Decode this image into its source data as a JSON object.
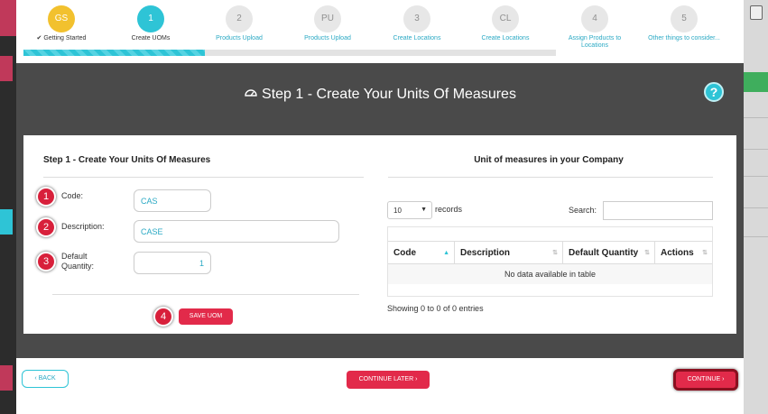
{
  "wizard": {
    "steps": [
      {
        "badge": "GS",
        "label": "Getting Started",
        "check": "✔",
        "state": "done"
      },
      {
        "badge": "1",
        "label": "Create UOMs",
        "state": "active"
      },
      {
        "badge": "2",
        "label": "Products Upload",
        "state": "todo"
      },
      {
        "badge": "PU",
        "label": "Products Upload",
        "state": "todo"
      },
      {
        "badge": "3",
        "label": "Create Locations",
        "state": "todo"
      },
      {
        "badge": "CL",
        "label": "Create Locations",
        "state": "todo"
      },
      {
        "badge": "4",
        "label": "Assign Products to Locations",
        "state": "todo"
      },
      {
        "badge": "5",
        "label": "Other things to consider...",
        "state": "todo"
      }
    ],
    "progress_fraction": 0.34
  },
  "header": {
    "title": "Step 1 - Create Your Units Of Measures",
    "help_icon": "?"
  },
  "form": {
    "title": "Step 1 - Create Your Units Of Measures",
    "fields": [
      {
        "num": "1",
        "label": "Code:",
        "value": "CAS"
      },
      {
        "num": "2",
        "label": "Description:",
        "value": "CASE"
      },
      {
        "num": "3",
        "label_line1": "Default",
        "label_line2": "Quantity:",
        "value": "1"
      }
    ],
    "save_num": "4",
    "save_label": "SAVE UOM"
  },
  "table": {
    "title": "Unit of measures in your Company",
    "page_size": "10",
    "records_label": "records",
    "search_label": "Search:",
    "columns": [
      "Code",
      "Description",
      "Default Quantity",
      "Actions"
    ],
    "empty_text": "No data available in table",
    "info_text": "Showing 0 to 0 of 0 entries"
  },
  "footer": {
    "back_label": "‹ BACK",
    "later_label": "CONTINUE LATER ›",
    "continue_label": "CONTINUE ›"
  },
  "colors": {
    "accent_red": "#e22a4a",
    "accent_teal": "#2ec4d6",
    "step_done": "#f2c12e"
  }
}
